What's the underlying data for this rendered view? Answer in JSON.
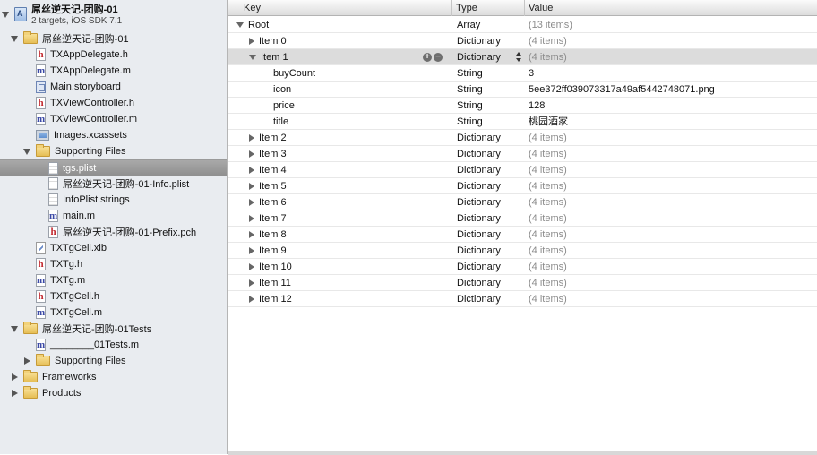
{
  "navigator": {
    "project_title": "屌丝逆天记-团购-01",
    "project_subtitle": "2 targets, iOS SDK 7.1",
    "items": [
      {
        "label": "屌丝逆天记-团购-01",
        "icon": "folder-icon",
        "level": 1,
        "disclosure": "open"
      },
      {
        "label": "TXAppDelegate.h",
        "icon": "header-file-icon",
        "level": 2,
        "disclosure": "none"
      },
      {
        "label": "TXAppDelegate.m",
        "icon": "source-file-icon",
        "level": 2,
        "disclosure": "none"
      },
      {
        "label": "Main.storyboard",
        "icon": "storyboard-icon",
        "level": 2,
        "disclosure": "none"
      },
      {
        "label": "TXViewController.h",
        "icon": "header-file-icon",
        "level": 2,
        "disclosure": "none"
      },
      {
        "label": "TXViewController.m",
        "icon": "source-file-icon",
        "level": 2,
        "disclosure": "none"
      },
      {
        "label": "Images.xcassets",
        "icon": "asset-catalog-icon",
        "level": 2,
        "disclosure": "none"
      },
      {
        "label": "Supporting Files",
        "icon": "folder-icon",
        "level": 2,
        "disclosure": "open"
      },
      {
        "label": "tgs.plist",
        "icon": "plist-file-icon",
        "level": 3,
        "disclosure": "none",
        "selected": true
      },
      {
        "label": "屌丝逆天记-团购-01-Info.plist",
        "icon": "plist-file-icon",
        "level": 3,
        "disclosure": "none"
      },
      {
        "label": "InfoPlist.strings",
        "icon": "strings-file-icon",
        "level": 3,
        "disclosure": "none"
      },
      {
        "label": "main.m",
        "icon": "source-file-icon",
        "level": 3,
        "disclosure": "none"
      },
      {
        "label": "屌丝逆天记-团购-01-Prefix.pch",
        "icon": "header-file-icon",
        "level": 3,
        "disclosure": "none"
      },
      {
        "label": "TXTgCell.xib",
        "icon": "xib-file-icon",
        "level": 2,
        "disclosure": "none"
      },
      {
        "label": "TXTg.h",
        "icon": "header-file-icon",
        "level": 2,
        "disclosure": "none"
      },
      {
        "label": "TXTg.m",
        "icon": "source-file-icon",
        "level": 2,
        "disclosure": "none"
      },
      {
        "label": "TXTgCell.h",
        "icon": "header-file-icon",
        "level": 2,
        "disclosure": "none"
      },
      {
        "label": "TXTgCell.m",
        "icon": "source-file-icon",
        "level": 2,
        "disclosure": "none"
      },
      {
        "label": "屌丝逆天记-团购-01Tests",
        "icon": "folder-icon",
        "level": 1,
        "disclosure": "open"
      },
      {
        "label": "________01Tests.m",
        "icon": "source-file-icon",
        "level": 2,
        "disclosure": "none"
      },
      {
        "label": "Supporting Files",
        "icon": "folder-icon",
        "level": 2,
        "disclosure": "closed"
      },
      {
        "label": "Frameworks",
        "icon": "folder-icon",
        "level": 1,
        "disclosure": "closed"
      },
      {
        "label": "Products",
        "icon": "folder-icon",
        "level": 1,
        "disclosure": "closed"
      }
    ]
  },
  "plist": {
    "columns": {
      "key": "Key",
      "type": "Type",
      "value": "Value"
    },
    "rows": [
      {
        "key": "Root",
        "type": "Array",
        "value": "(13 items)",
        "depth": 0,
        "disclosure": "open",
        "muted": true
      },
      {
        "key": "Item 0",
        "type": "Dictionary",
        "value": "(4 items)",
        "depth": 1,
        "disclosure": "closed",
        "muted": true
      },
      {
        "key": "Item 1",
        "type": "Dictionary",
        "value": "(4 items)",
        "depth": 1,
        "disclosure": "open",
        "muted": true,
        "selected": true
      },
      {
        "key": "buyCount",
        "type": "String",
        "value": "3",
        "depth": 2,
        "disclosure": "none"
      },
      {
        "key": "icon",
        "type": "String",
        "value": "5ee372ff039073317a49af5442748071.png",
        "depth": 2,
        "disclosure": "none"
      },
      {
        "key": "price",
        "type": "String",
        "value": "128",
        "depth": 2,
        "disclosure": "none"
      },
      {
        "key": "title",
        "type": "String",
        "value": "桃园酒家",
        "depth": 2,
        "disclosure": "none"
      },
      {
        "key": "Item 2",
        "type": "Dictionary",
        "value": "(4 items)",
        "depth": 1,
        "disclosure": "closed",
        "muted": true
      },
      {
        "key": "Item 3",
        "type": "Dictionary",
        "value": "(4 items)",
        "depth": 1,
        "disclosure": "closed",
        "muted": true
      },
      {
        "key": "Item 4",
        "type": "Dictionary",
        "value": "(4 items)",
        "depth": 1,
        "disclosure": "closed",
        "muted": true
      },
      {
        "key": "Item 5",
        "type": "Dictionary",
        "value": "(4 items)",
        "depth": 1,
        "disclosure": "closed",
        "muted": true
      },
      {
        "key": "Item 6",
        "type": "Dictionary",
        "value": "(4 items)",
        "depth": 1,
        "disclosure": "closed",
        "muted": true
      },
      {
        "key": "Item 7",
        "type": "Dictionary",
        "value": "(4 items)",
        "depth": 1,
        "disclosure": "closed",
        "muted": true
      },
      {
        "key": "Item 8",
        "type": "Dictionary",
        "value": "(4 items)",
        "depth": 1,
        "disclosure": "closed",
        "muted": true
      },
      {
        "key": "Item 9",
        "type": "Dictionary",
        "value": "(4 items)",
        "depth": 1,
        "disclosure": "closed",
        "muted": true
      },
      {
        "key": "Item 10",
        "type": "Dictionary",
        "value": "(4 items)",
        "depth": 1,
        "disclosure": "closed",
        "muted": true
      },
      {
        "key": "Item 11",
        "type": "Dictionary",
        "value": "(4 items)",
        "depth": 1,
        "disclosure": "closed",
        "muted": true
      },
      {
        "key": "Item 12",
        "type": "Dictionary",
        "value": "(4 items)",
        "depth": 1,
        "disclosure": "closed",
        "muted": true
      }
    ],
    "selected_row_buttons": [
      "add-icon",
      "remove-icon"
    ],
    "selected_row_stepper": "type-stepper-icon"
  }
}
